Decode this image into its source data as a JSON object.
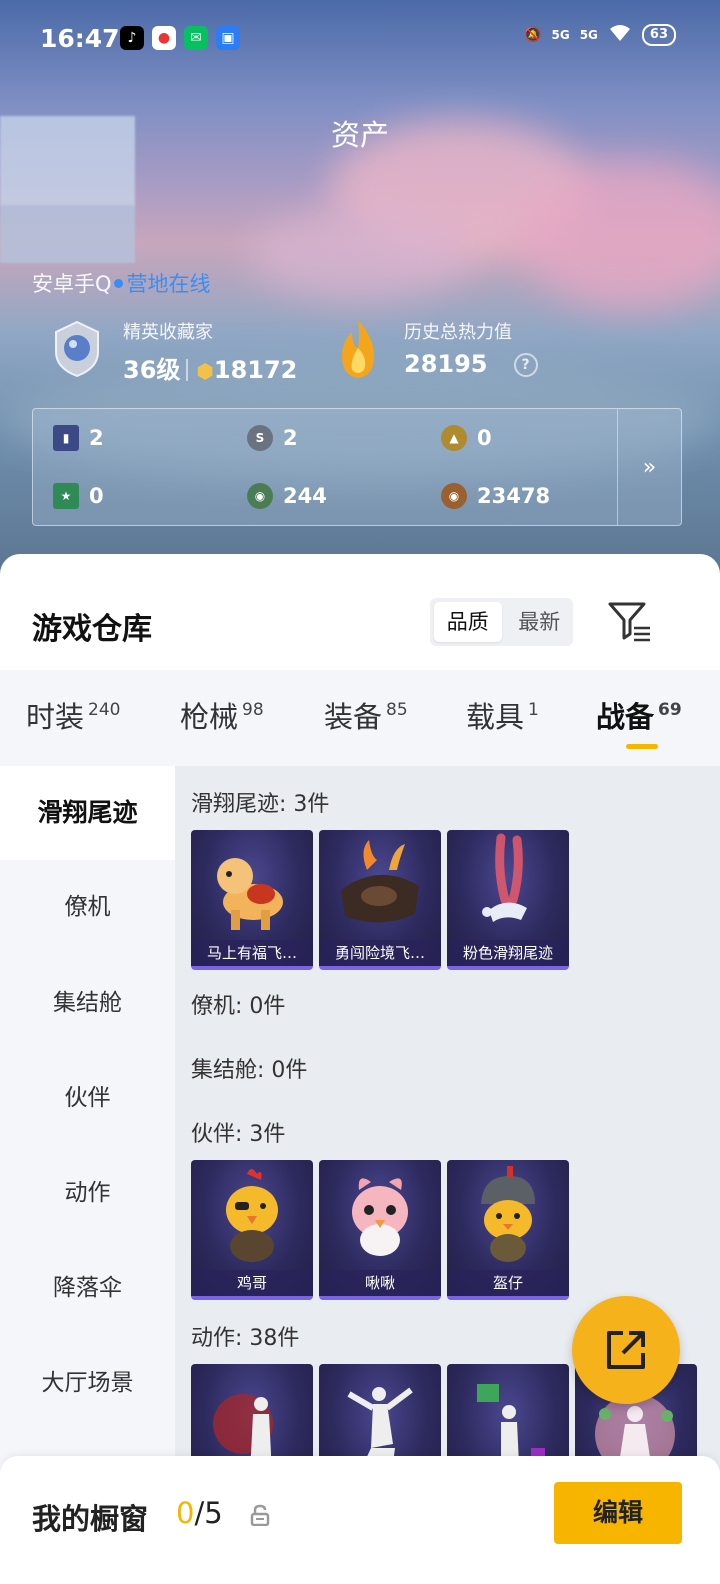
{
  "status_bar": {
    "time": "16:47",
    "signal_1": "5G",
    "signal_2": "5G",
    "battery": "63"
  },
  "header": {
    "title": "资产",
    "login_platform": "安卓手Q",
    "online_status": "营地在线"
  },
  "stats": {
    "collector_label": "精英收藏家",
    "collector_level": "36级",
    "collector_points": "18172",
    "heat_label": "历史总热力值",
    "heat_value": "28195",
    "help": "?"
  },
  "currencies": [
    {
      "icon": "card-icon",
      "value": "2",
      "color": "#3b4a86"
    },
    {
      "icon": "silver-coin-icon",
      "value": "2",
      "color": "#6b7280"
    },
    {
      "icon": "gold-triangle-coin-icon",
      "value": "0",
      "color": "#b08a2e"
    },
    {
      "icon": "green-ticket-icon",
      "value": "0",
      "color": "#2f8a57"
    },
    {
      "icon": "green-coin-icon",
      "value": "244",
      "color": "#4b7d55"
    },
    {
      "icon": "bronze-coin-icon",
      "value": "23478",
      "color": "#9a6030"
    }
  ],
  "currency_more": "»",
  "warehouse": {
    "title": "游戏仓库",
    "sort_options": [
      "品质",
      "最新"
    ],
    "sort_active": "品质"
  },
  "tabs": [
    {
      "label": "时装",
      "count": "240"
    },
    {
      "label": "枪械",
      "count": "98"
    },
    {
      "label": "装备",
      "count": "85"
    },
    {
      "label": "载具",
      "count": "1"
    },
    {
      "label": "战备",
      "count": "69"
    }
  ],
  "active_tab": "战备",
  "sidebar": [
    {
      "label": "滑翔尾迹"
    },
    {
      "label": "僚机"
    },
    {
      "label": "集结舱"
    },
    {
      "label": "伙伴"
    },
    {
      "label": "动作"
    },
    {
      "label": "降落伞"
    },
    {
      "label": "大厅场景"
    }
  ],
  "sections": {
    "glide": {
      "title": "滑翔尾迹: 3件",
      "items": [
        "马上有福飞…",
        "勇闯险境飞…",
        "粉色滑翔尾迹"
      ]
    },
    "wingman": {
      "title": "僚机: 0件"
    },
    "capsule": {
      "title": "集结舱: 0件"
    },
    "partner": {
      "title": "伙伴: 3件",
      "items": [
        "鸡哥",
        "啾啾",
        "盔仔"
      ]
    },
    "emote": {
      "title": "动作: 38件"
    }
  },
  "bottom_bar": {
    "label": "我的橱窗",
    "current": "0",
    "total": "/5",
    "edit": "编辑"
  },
  "colors": {
    "accent": "#f7b500",
    "link": "#3a8df5",
    "card_border": "#7b63e6"
  }
}
